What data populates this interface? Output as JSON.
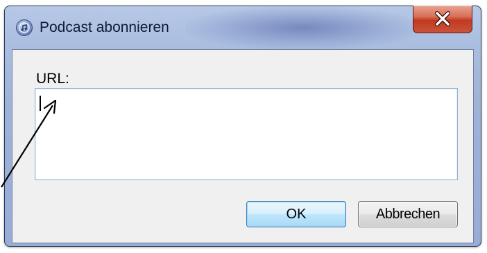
{
  "window": {
    "title": "Podcast abonnieren",
    "close_glyph": "X"
  },
  "form": {
    "url_label": "URL:",
    "url_value": "",
    "url_placeholder": ""
  },
  "buttons": {
    "ok_label": "OK",
    "cancel_label": "Abbrechen"
  },
  "icons": {
    "app_icon": "itunes-note-icon",
    "close_icon": "close-icon"
  },
  "colors": {
    "title_bar": "#a9bde0",
    "close_button": "#c9543b",
    "default_button_border": "#3c7fb1",
    "input_border": "#8fb4d9",
    "client_background": "#f0f0f0"
  }
}
